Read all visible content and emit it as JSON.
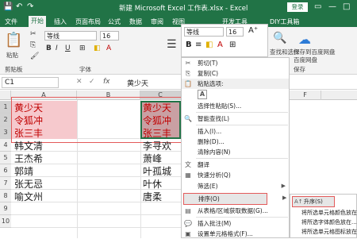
{
  "title": "新建 Microsoft Excel 工作表.xlsx - Excel",
  "login": "登录",
  "tabs": [
    "文件",
    "开始",
    "插入",
    "页面布局",
    "公式",
    "数据",
    "审阅",
    "视图",
    "开发工具",
    "DIY工具箱"
  ],
  "ribbon": {
    "font_name": "等线",
    "font_size": "16",
    "font_group": "字体",
    "paste": "粘贴",
    "clipboard": "剪贴板",
    "find_select": "查找和选择",
    "baidu": "百度网盘",
    "baidu2": "保存到百度网盘",
    "save": "保存"
  },
  "formula_bar": {
    "name_box": "C1",
    "value": "黄少天",
    "fx": "fx"
  },
  "columns": [
    "A",
    "B",
    "C",
    "F"
  ],
  "rows": [
    "1",
    "2",
    "3",
    "4",
    "5",
    "6",
    "7",
    "8",
    "9",
    "10"
  ],
  "col_a": [
    "黄少天",
    "令狐冲",
    "张三丰",
    "韩文清",
    "王杰希",
    "郭靖",
    "张无忌",
    "喻文州"
  ],
  "col_c": [
    "黄少天",
    "令狐冲",
    "张三丰",
    "李寻欢",
    "萧峰",
    "叶孤城",
    "叶休",
    "唐柔"
  ],
  "mini_toolbar": {
    "font": "等线",
    "size": "16",
    "bold": "B"
  },
  "menu": [
    {
      "icon": "✂",
      "label": "剪切(T)"
    },
    {
      "icon": "⎘",
      "label": "复制(C)"
    },
    {
      "icon": "📋",
      "label": "粘贴选项:"
    },
    {
      "icon": "A",
      "label": ""
    },
    {
      "icon": "",
      "label": "选择性粘贴(S)..."
    },
    {
      "icon": "🔍",
      "label": "智能查找(L)"
    },
    {
      "icon": "",
      "label": "插入(I)..."
    },
    {
      "icon": "",
      "label": "删除(D)..."
    },
    {
      "icon": "",
      "label": "清除内容(N)"
    },
    {
      "icon": "文",
      "label": "翻译"
    },
    {
      "icon": "▦",
      "label": "快速分析(Q)"
    },
    {
      "icon": "",
      "label": "筛选(E)"
    },
    {
      "icon": "",
      "label": "排序(O)"
    },
    {
      "icon": "▤",
      "label": "从表格/区域获取数据(G)..."
    },
    {
      "icon": "💬",
      "label": "插入批注(M)"
    },
    {
      "icon": "▣",
      "label": "设置单元格格式(F)..."
    }
  ],
  "submenu": [
    {
      "icon": "A↑",
      "label": "升序(S)"
    },
    {
      "icon": "",
      "label": "将所选单元格颜色放在..."
    },
    {
      "icon": "",
      "label": "将所选字体颜色放在..."
    },
    {
      "icon": "",
      "label": "将所选单元格图标放在..."
    }
  ]
}
